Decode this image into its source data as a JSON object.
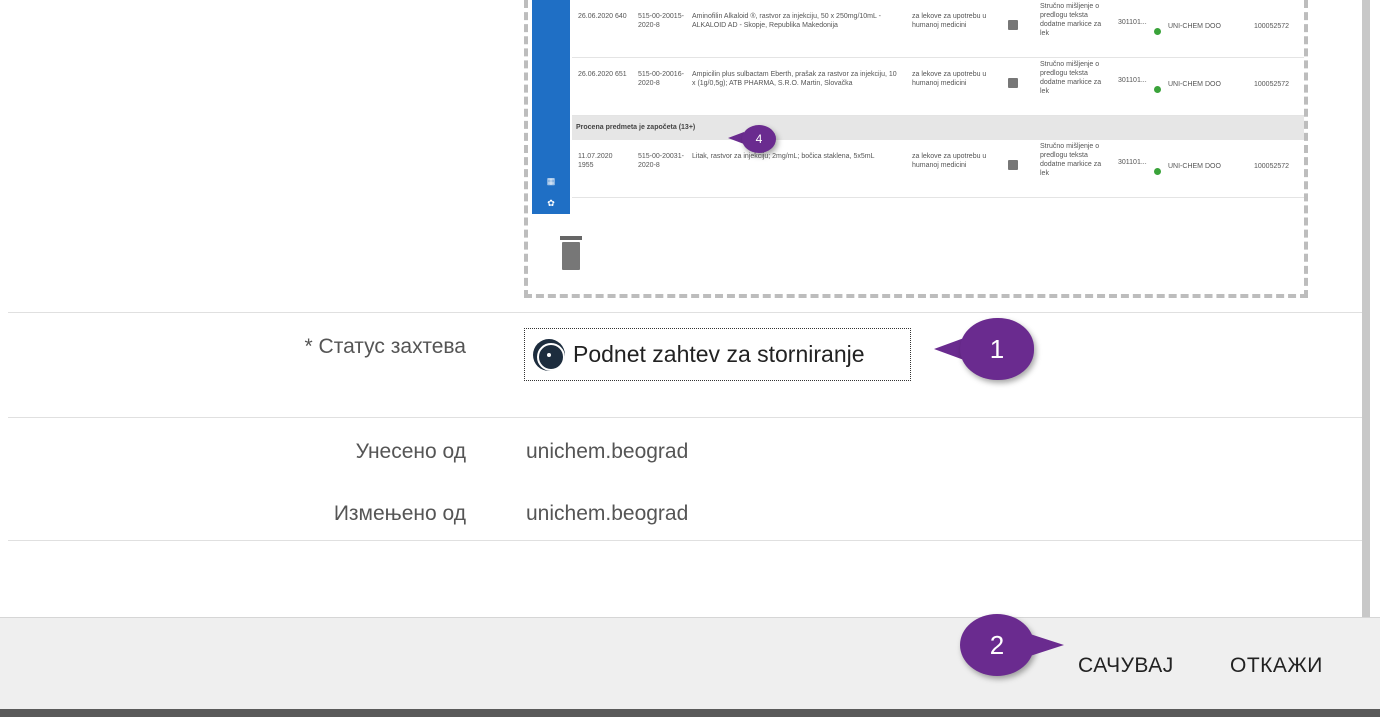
{
  "preview": {
    "rows": [
      {
        "date": "26.06.2020 640",
        "num": "515-00-20015-2020-8",
        "desc": "Aminofilin Alkaloid ®, rastvor za injekciju, 50 x 250mg/10mL - ALKALOID AD - Skopje, Republika Makedonija",
        "type": "za lekove za upotrebu u humanoj medicini",
        "doc": "Stručno mišljenje o predlogu teksta dodatne markice za lek",
        "code": "301101...",
        "company": "UNI-CHEM DOO",
        "id": "100052572"
      },
      {
        "date": "26.06.2020 651",
        "num": "515-00-20016-2020-8",
        "desc": "Ampicilin plus sulbactam Eberth, prašak za rastvor za injekciju, 10 x (1g/0,5g); ATB PHARMA, S.R.O. Martin, Slovačka",
        "type": "za lekove za upotrebu u humanoj medicini",
        "doc": "Stručno mišljenje o predlogu teksta dodatne markice za lek",
        "code": "301101...",
        "company": "UNI-CHEM DOO",
        "id": "100052572"
      },
      {
        "date": "11.07.2020 1955",
        "num": "515-00-20031-2020-8",
        "desc": "Litak, rastvor za injekciju; 2mg/mL; bočica staklena, 5x5mL",
        "type": "za lekove za upotrebu u humanoj medicini",
        "doc": "Stručno mišljenje o predlogu teksta dodatne markice za lek",
        "code": "301101...",
        "company": "UNI-CHEM DOO",
        "id": "100052572"
      }
    ],
    "group_label": "Procena predmeta je započeta (13+)",
    "badge": "4"
  },
  "form": {
    "status_label": "* Статус захтева",
    "status_value": "Podnet zahtev za storniranje",
    "entered_by_label": "Унесено од",
    "entered_by_value": "unichem.beograd",
    "changed_by_label": "Измењено од",
    "changed_by_value": "unichem.beograd"
  },
  "footer": {
    "save_label": "САЧУВАЈ",
    "cancel_label": "ОТКАЖИ"
  },
  "callouts": {
    "one": "1",
    "two": "2"
  },
  "colors": {
    "accent_blue": "#1f6fc5",
    "callout_purple": "#6a2b8f"
  }
}
